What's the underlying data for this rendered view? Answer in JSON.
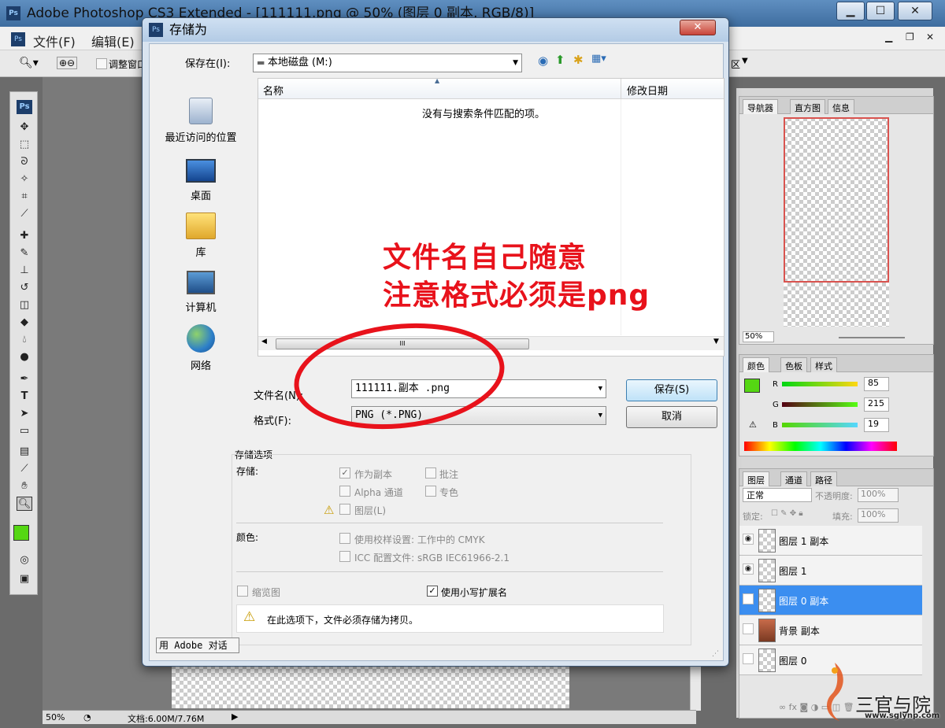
{
  "app": {
    "title": "Adobe Photoshop CS3 Extended - [111111.png @ 50% (图层 0 副本, RGB/8)]",
    "ps_badge": "Ps",
    "menu": [
      "文件(F)",
      "编辑(E)"
    ],
    "options_label": "调整窗口",
    "options_right": "区",
    "zoom": "50%",
    "doc_size": "文档:6.00M/7.76M"
  },
  "panels": {
    "navigator_tabs": [
      "导航器",
      "直方图",
      "信息"
    ],
    "navigator_zoom": "50%",
    "color_tabs": [
      "颜色",
      "色板",
      "样式"
    ],
    "color": {
      "r": "85",
      "g": "215",
      "b": "19",
      "r_label": "R",
      "g_label": "G",
      "b_label": "B",
      "fg_color": "#55d713"
    },
    "layer_tabs": [
      "图层",
      "通道",
      "路径"
    ],
    "blend_mode": "正常",
    "opacity_label": "不透明度:",
    "opacity": "100%",
    "lock_label": "锁定:",
    "fill_label": "填充:",
    "fill": "100%",
    "layers": [
      {
        "name": "图层 1 副本",
        "visible": true,
        "selected": false
      },
      {
        "name": "图层 1",
        "visible": true,
        "selected": false
      },
      {
        "name": "图层 0 副本",
        "visible": false,
        "selected": true
      },
      {
        "name": "背景 副本",
        "visible": false,
        "selected": false
      },
      {
        "name": "图层 0",
        "visible": false,
        "selected": false
      }
    ]
  },
  "dialog": {
    "title": "存储为",
    "save_in_label": "保存在(I):",
    "save_in_value": "本地磁盘 (M:)",
    "places": [
      "最近访问的位置",
      "桌面",
      "库",
      "计算机",
      "网络"
    ],
    "col_name": "名称",
    "col_date": "修改日期",
    "empty_message": "没有与搜索条件匹配的项。",
    "filename_label": "文件名(N):",
    "filename_value": "111111.副本 .png",
    "format_label": "格式(F):",
    "format_value": "PNG (*.PNG)",
    "save_button": "保存(S)",
    "cancel_button": "取消",
    "options_group": "存储选项",
    "storage_label": "存储:",
    "as_copy": "作为副本",
    "annotations": "批注",
    "alpha": "Alpha 通道",
    "spot": "专色",
    "layers": "图层(L)",
    "color_label": "颜色:",
    "proof": "使用校样设置: 工作中的 CMYK",
    "icc": "ICC 配置文件: sRGB IEC61966-2.1",
    "thumbnail": "缩览图",
    "lowercase": "使用小写扩展名",
    "warning": "在此选项下，文件必须存储为拷贝。",
    "adobe_dialog": "用 Adobe 对话"
  },
  "annotation": {
    "line1": "文件名自己随意",
    "line2": "注意格式必须是png",
    "color": "#e8121b"
  }
}
